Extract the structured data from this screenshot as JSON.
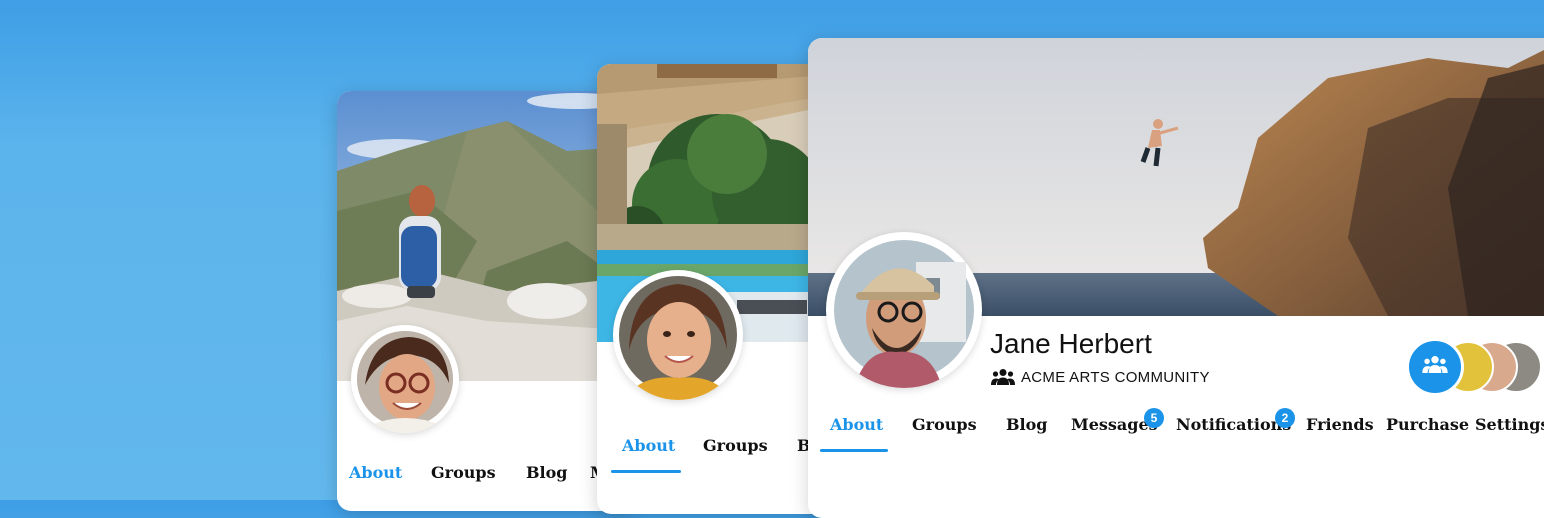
{
  "cards": {
    "card1": {
      "tabs": [
        {
          "label": "About",
          "active": true
        },
        {
          "label": "Groups"
        },
        {
          "label": "Blog"
        },
        {
          "label": "M"
        }
      ]
    },
    "card2": {
      "tabs": [
        {
          "label": "About",
          "active": true
        },
        {
          "label": "Groups"
        },
        {
          "label": "B"
        }
      ]
    },
    "card3": {
      "profile_name": "Jane Herbert",
      "community_label": "ACME ARTS COMMUNITY",
      "community_icon": "group-icon",
      "members_icon": "group-icon",
      "tabs": [
        {
          "label": "About",
          "active": true
        },
        {
          "label": "Groups"
        },
        {
          "label": "Blog"
        },
        {
          "label": "Messages",
          "badge": "5"
        },
        {
          "label": "Notifications",
          "badge": "2"
        },
        {
          "label": "Friends"
        },
        {
          "label": "Purchase"
        },
        {
          "label": "Settings"
        }
      ]
    }
  },
  "colors": {
    "accent": "#1a93e8",
    "background": "#5cb4ec"
  }
}
